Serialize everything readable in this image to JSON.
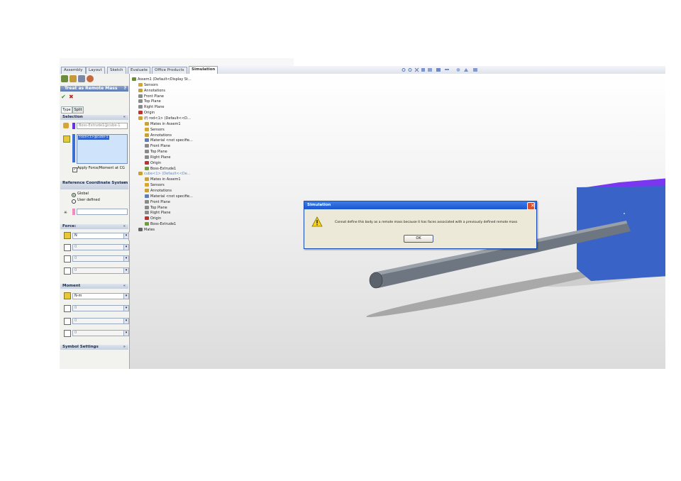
{
  "tabs": [
    "Assembly",
    "Layout",
    "Sketch",
    "Evaluate",
    "Office Products",
    "Simulation"
  ],
  "active_tab": "Simulation",
  "property_manager": {
    "title": "Treat as Remote Mass",
    "help": "?",
    "ok": "✔",
    "cancel": "✖",
    "subtabs": [
      "Type",
      "Split"
    ],
    "selection": {
      "header": "Selection",
      "body_field": "Boss-Extrude1@cube-1",
      "faces_item": "Face<1>@cube-1",
      "apply_checkbox": "Apply Force/Moment at CG"
    },
    "reference": {
      "header": "Reference Coordinate System",
      "global": "Global",
      "user_defined": "User defined"
    },
    "force": {
      "header": "Force:",
      "unit": "N",
      "values": [
        "0",
        "0",
        "0"
      ]
    },
    "moment": {
      "header": "Moment",
      "unit": "N-m",
      "values": [
        "0",
        "0",
        "0"
      ]
    },
    "symbol_settings": "Symbol Settings",
    "collapse": "«",
    "expand": "»"
  },
  "tree": [
    {
      "indent": 0,
      "label": "Assem1  (Default<Display St...",
      "icon": "assembly"
    },
    {
      "indent": 1,
      "label": "Sensors",
      "icon": "sensor"
    },
    {
      "indent": 1,
      "label": "Annotations",
      "icon": "annotation"
    },
    {
      "indent": 1,
      "label": "Front Plane",
      "icon": "plane"
    },
    {
      "indent": 1,
      "label": "Top Plane",
      "icon": "plane"
    },
    {
      "indent": 1,
      "label": "Right Plane",
      "icon": "plane"
    },
    {
      "indent": 1,
      "label": "Origin",
      "icon": "origin"
    },
    {
      "indent": 1,
      "label": "(f) rod<1> (Default<<D...",
      "icon": "part"
    },
    {
      "indent": 2,
      "label": "Mates in Assem1",
      "icon": "mate"
    },
    {
      "indent": 2,
      "label": "Sensors",
      "icon": "sensor"
    },
    {
      "indent": 2,
      "label": "Annotations",
      "icon": "annotation"
    },
    {
      "indent": 2,
      "label": "Material <not specifie...",
      "icon": "material"
    },
    {
      "indent": 2,
      "label": "Front Plane",
      "icon": "plane"
    },
    {
      "indent": 2,
      "label": "Top Plane",
      "icon": "plane"
    },
    {
      "indent": 2,
      "label": "Right Plane",
      "icon": "plane"
    },
    {
      "indent": 2,
      "label": "Origin",
      "icon": "origin"
    },
    {
      "indent": 2,
      "label": "Boss-Extrude1",
      "icon": "feature"
    },
    {
      "indent": 1,
      "label": "cube<1> (Default<<De...",
      "icon": "part",
      "highlight": true
    },
    {
      "indent": 2,
      "label": "Mates in Assem1",
      "icon": "mate"
    },
    {
      "indent": 2,
      "label": "Sensors",
      "icon": "sensor"
    },
    {
      "indent": 2,
      "label": "Annotations",
      "icon": "annotation"
    },
    {
      "indent": 2,
      "label": "Material <not specifie...",
      "icon": "material"
    },
    {
      "indent": 2,
      "label": "Front Plane",
      "icon": "plane"
    },
    {
      "indent": 2,
      "label": "Top Plane",
      "icon": "plane"
    },
    {
      "indent": 2,
      "label": "Right Plane",
      "icon": "plane"
    },
    {
      "indent": 2,
      "label": "Origin",
      "icon": "origin"
    },
    {
      "indent": 2,
      "label": "Boss-Extrude1",
      "icon": "feature"
    },
    {
      "indent": 1,
      "label": "Mates",
      "icon": "mates"
    }
  ],
  "dialog": {
    "title": "Simulation",
    "message": "Cannot define this body as a remote mass because it has faces associated with a previously defined remote mass",
    "ok": "OK",
    "close": "✕"
  },
  "colors": {
    "cube_front": "#3a63c8",
    "cube_side": "#6a2fe0",
    "cube_top": "#7a36f0",
    "rod": "#6e7681",
    "selection_blue": "#cfe4fb"
  }
}
